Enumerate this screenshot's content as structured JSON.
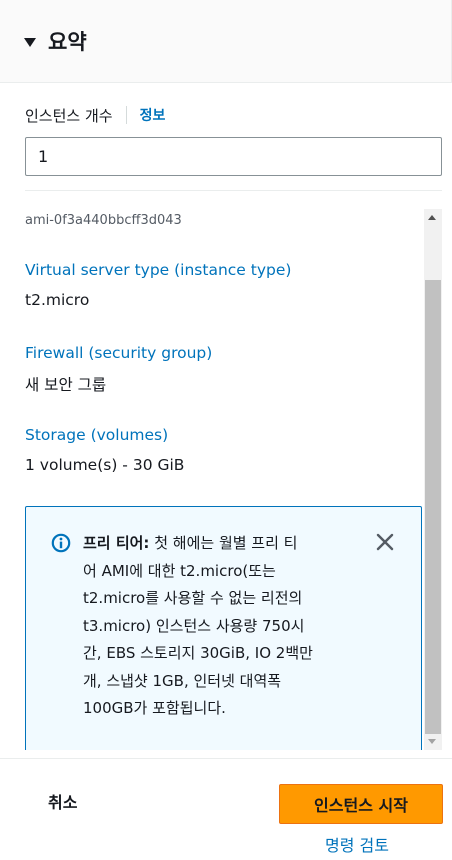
{
  "summary": {
    "title": "요약"
  },
  "instance_count": {
    "label": "인스턴스 개수",
    "info": "정보",
    "value": "1"
  },
  "details": {
    "ami": "ami-0f3a440bbcff3d043",
    "instance_type_label": "Virtual server type (instance type)",
    "instance_type_value": "t2.micro",
    "firewall_label": "Firewall (security group)",
    "firewall_value": "새 보안 그룹",
    "storage_label": "Storage (volumes)",
    "storage_value": "1 volume(s) - 30 GiB"
  },
  "free_tier_alert": {
    "title": "프리 티어:",
    "lines": [
      "첫 해에는 월별 프리 티",
      "어 AMI에 대한 t2.micro(또는",
      "t2.micro를 사용할 수 없는 리전의",
      "t3.micro) 인스턴스 사용량 750시",
      "간, EBS 스토리지 30GiB, IO 2백만",
      "개, 스냅샷 1GB, 인터넷 대역폭",
      "100GB가 포함됩니다."
    ],
    "icon": "info-icon",
    "close_icon": "close-icon"
  },
  "footer": {
    "cancel_label": "취소",
    "launch_label": "인스턴스 시작",
    "review_label": "명령 검토"
  },
  "colors": {
    "link": "#0073bb",
    "primary_button": "#ff9900",
    "alert_background": "#f1faff"
  }
}
